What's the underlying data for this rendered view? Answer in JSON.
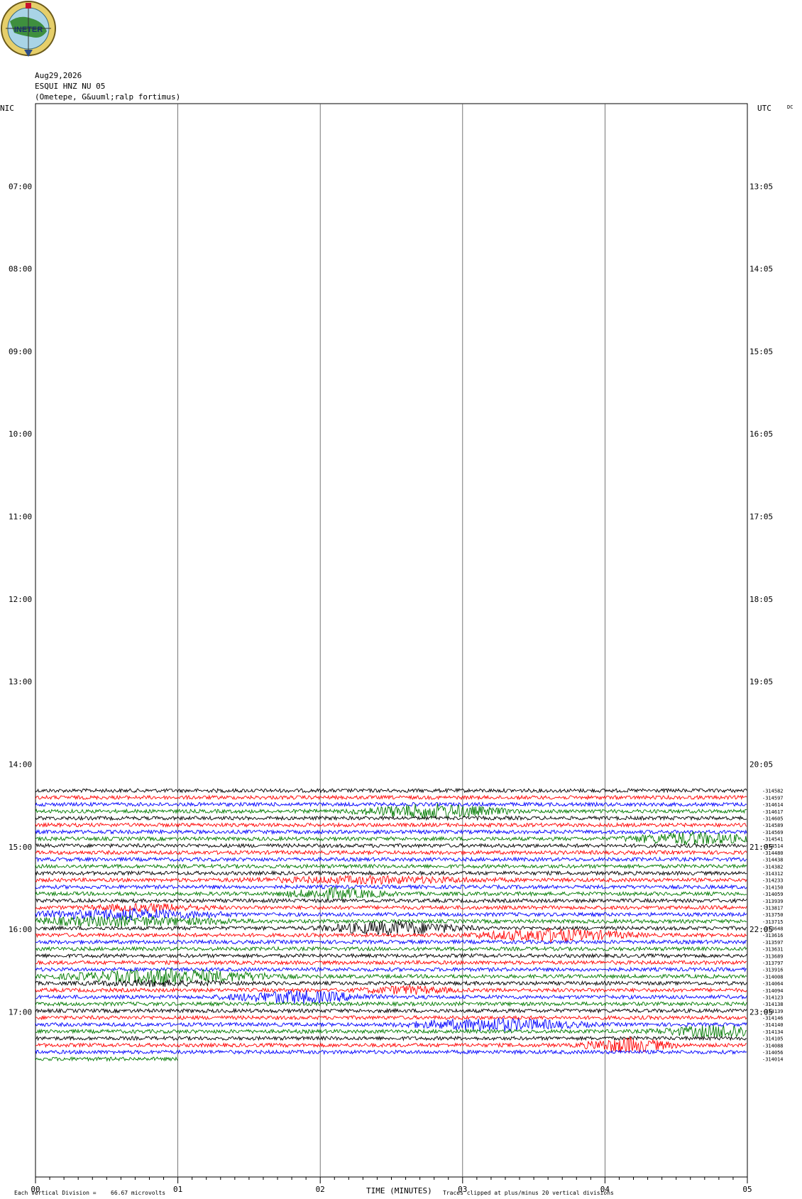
{
  "header": {
    "logo_text": "INETER",
    "date": "Aug29,2026",
    "station": "ESQUI HNZ NU 05",
    "location": "(Ometepe, G&uuml;ralp fortimus)"
  },
  "axis_labels": {
    "left_tz": "NIC",
    "right_tz": "UTC",
    "dc": "DC",
    "x_title": "TIME (MINUTES)"
  },
  "footer": {
    "division_note": "Each Vertical Division =",
    "division_value": "66.67 microvolts",
    "clip_note": "Traces clipped at plus/minus 20 vertical divisions"
  },
  "chart_data": {
    "type": "line",
    "title": "",
    "xlabel": "TIME (MINUTES)",
    "xlim": [
      0,
      5
    ],
    "x_ticks": [
      "00",
      "01",
      "02",
      "03",
      "04",
      "05"
    ],
    "left_hour_labels": [
      "07:00",
      "08:00",
      "09:00",
      "10:00",
      "11:00",
      "12:00",
      "13:00",
      "14:00",
      "15:00",
      "16:00",
      "17:00"
    ],
    "right_hour_labels": [
      "13:05",
      "14:05",
      "15:05",
      "16:05",
      "17:05",
      "18:05",
      "19:05",
      "20:05",
      "21:05",
      "22:05",
      "23:05"
    ],
    "trace_colors": [
      "#000000",
      "#ff0000",
      "#0000ff",
      "#007a00"
    ],
    "first_trace_hour": 14.32,
    "trace_interval_minutes": 5,
    "dc_offsets": [
      "-314582",
      "-314597",
      "-314614",
      "-314617",
      "-314605",
      "-314589",
      "-314569",
      "-314541",
      "-314514",
      "-314480",
      "-314438",
      "-314382",
      "-314312",
      "-314233",
      "-314150",
      "-314059",
      "-313939",
      "-313817",
      "-313750",
      "-313715",
      "-313648",
      "-313616",
      "-313597",
      "-313631",
      "-313689",
      "-313797",
      "-313916",
      "-314008",
      "-314064",
      "-314094",
      "-314123",
      "-314138",
      "-314139",
      "-314146",
      "-314140",
      "-314134",
      "-314105",
      "-314088",
      "-314056",
      "-314014"
    ],
    "last_trace_fraction": 0.2
  }
}
